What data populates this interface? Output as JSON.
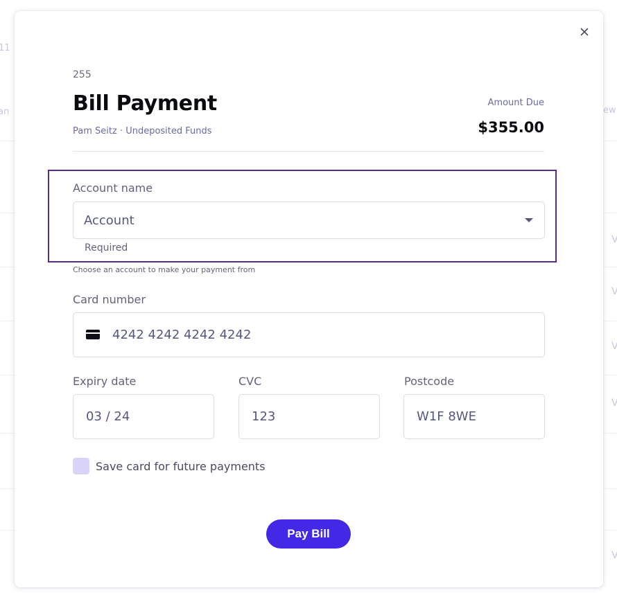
{
  "background": {
    "fragments": [
      "11",
      "tan",
      "ew"
    ],
    "row_link_glyph": "V"
  },
  "modal": {
    "close_glyph": "×",
    "bill_number": "255",
    "title": "Bill Payment",
    "subtitle": "Pam Seitz · Undeposited Funds",
    "amount_label": "Amount Due",
    "amount_value": "$355.00",
    "account": {
      "label": "Account name",
      "placeholder": "Account",
      "required": "Required",
      "helper": "Choose an account to make your payment from"
    },
    "card": {
      "label": "Card number",
      "value": "4242 4242 4242 4242"
    },
    "expiry": {
      "label": "Expiry date",
      "value": "03 / 24"
    },
    "cvc": {
      "label": "CVC",
      "value": "123"
    },
    "postcode": {
      "label": "Postcode",
      "value": "W1F 8WE"
    },
    "save_card": {
      "label": "Save card for future payments",
      "checked": false
    },
    "pay_button": "Pay Bill"
  },
  "colors": {
    "accent": "#4328e6",
    "highlight_border": "#5b2a86",
    "checkbox_fill": "#d9d3f7"
  }
}
